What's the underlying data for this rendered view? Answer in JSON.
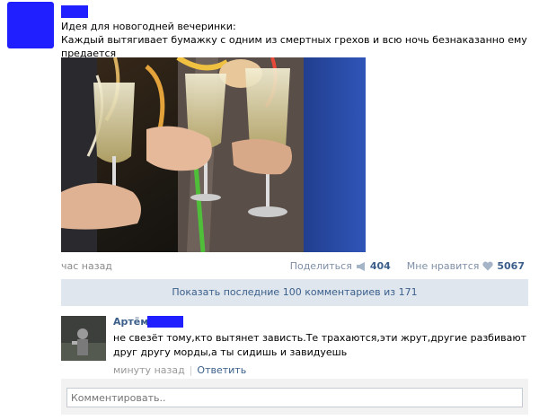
{
  "post": {
    "text_line1": "Идея для новогодней вечеринки:",
    "text_line2": "Каждый вытягивает бумажку с одним из смертных грехов и всю ночь безнаказанно ему предается",
    "time": "час назад",
    "share_label": "Поделиться",
    "share_count": "404",
    "like_label": "Мне нравится",
    "like_count": "5067"
  },
  "comments_bar": {
    "label": "Показать последние 100 комментариев из 171"
  },
  "comment": {
    "author": "Артём",
    "text": "не свезёт тому,кто вытянет зависть.Те трахаются,эти жрут,другие разбивают друг другу морды,а ты сидишь и завидуешь",
    "time": "минуту назад",
    "reply_label": "Ответить"
  },
  "comment_input": {
    "placeholder": "Комментировать.."
  },
  "colors": {
    "link": "#3b5f8a",
    "redaction": "#1f1fff",
    "bar": "#dfe6ee"
  },
  "icons": [
    "megaphone-icon",
    "heart-icon"
  ]
}
